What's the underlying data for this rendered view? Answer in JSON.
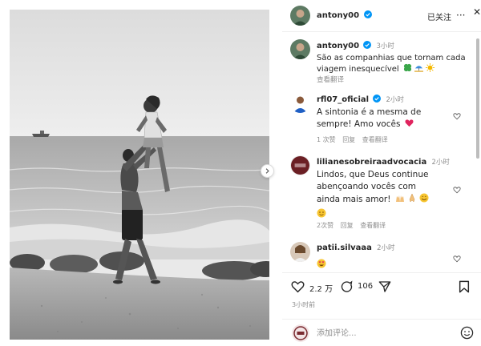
{
  "header": {
    "username": "antony00",
    "follow_status": "已关注",
    "more": "···",
    "close": "✕"
  },
  "caption": {
    "username": "antony00",
    "time": "3小时",
    "text_line1": "São as companhias que tornam cada",
    "text_line2": "viagem inesquecível",
    "emojis": [
      "clover-emoji",
      "beach-umbrella-emoji",
      "sun-emoji"
    ],
    "translate": "查看翻译"
  },
  "comments": [
    {
      "username": "rfl07_oficial",
      "verified": true,
      "time": "2小时",
      "lines": [
        "A sintonia é a mesma de",
        "sempre! Amo vocês"
      ],
      "emoji": "red-heart-emoji",
      "likes": "1 次赞",
      "reply": "回复",
      "translate": "查看翻译"
    },
    {
      "username": "lilianesobreiraadvocacia",
      "verified": false,
      "time": "2小时",
      "lines": [
        "Lindos, que Deus continue",
        "abençoando vocês com",
        "ainda mais amor!"
      ],
      "emojis": [
        "raising-hands-emoji",
        "praying-hands-emoji",
        "smiling-emoji",
        "grin-emoji"
      ],
      "likes": "2次赞",
      "reply": "回复",
      "translate": "查看翻译"
    },
    {
      "username": "patii.silvaaa",
      "verified": false,
      "time": "2小时",
      "emojis": [
        "heart-eyes-emoji"
      ]
    }
  ],
  "actions": {
    "likes_count": "2.2 万",
    "comments_count": "106",
    "time_ago": "3小时前"
  },
  "comment_bar": {
    "placeholder": "添加评论..."
  },
  "colors": {
    "verified_blue": "#0095f6",
    "heart_red": "#e0245e",
    "muted_text": "#8e8e8e"
  }
}
